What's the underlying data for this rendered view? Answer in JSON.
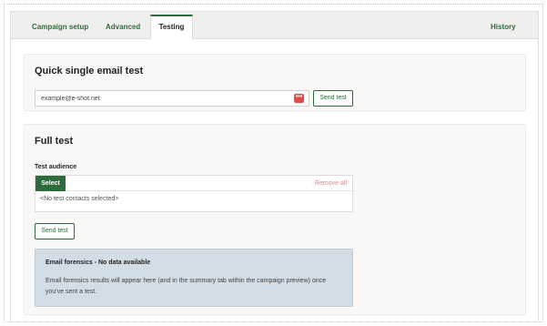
{
  "tabs": {
    "campaign_setup": "Campaign setup",
    "advanced": "Advanced",
    "testing": "Testing",
    "history": "History",
    "active": "Testing"
  },
  "quick_test": {
    "title": "Quick single email test",
    "email_value": "example@e-shot.net",
    "send_label": "Send test",
    "input_icon": "more-dots-icon"
  },
  "full_test": {
    "title": "Full test",
    "audience_label": "Test audience",
    "select_label": "Select",
    "remove_all_label": "Remove all",
    "empty_text": "<No test contacts selected>",
    "send_label": "Send test"
  },
  "forensics": {
    "title": "Email forensics - No data available",
    "body": "Email forensics results will appear here (and in the summary tab within the campaign preview) once you've sent a test."
  },
  "colors": {
    "accent": "#2e6b3a",
    "danger_badge": "#e14b4b",
    "info_bg": "#d3dde6",
    "remove_link": "#d98a8a"
  }
}
